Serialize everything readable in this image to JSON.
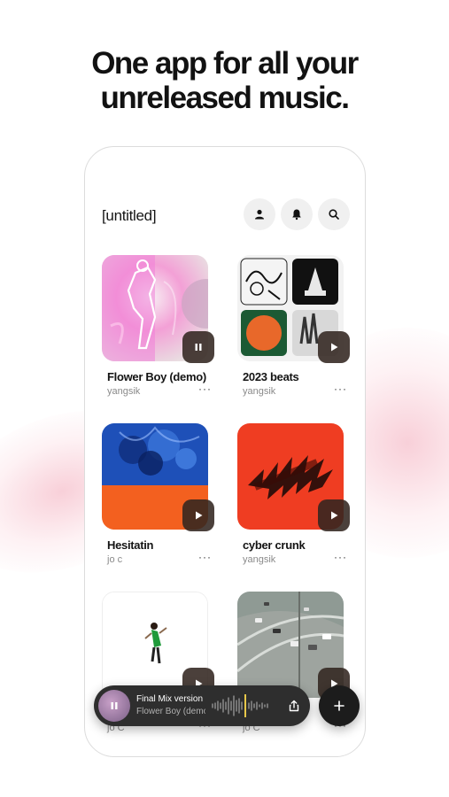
{
  "headline": {
    "line1": "One app for all your",
    "line2": "unreleased music."
  },
  "app": {
    "title": "[untitled]",
    "header_icons": [
      "profile-icon",
      "bell-icon",
      "search-icon"
    ]
  },
  "cards": [
    {
      "title": "Flower Boy (demo)",
      "artist": "yangsik",
      "state": "pause",
      "more": "···"
    },
    {
      "title": "2023 beats",
      "artist": "yangsik",
      "state": "play",
      "more": "···"
    },
    {
      "title": "Hesitatin",
      "artist": "jo c",
      "state": "play",
      "more": "···"
    },
    {
      "title": "cyber crunk",
      "artist": "yangsik",
      "state": "play",
      "more": "···"
    },
    {
      "title": "",
      "artist": "jo C",
      "state": "play",
      "more": "···"
    },
    {
      "title": "",
      "artist": "jo C",
      "state": "play",
      "more": "···"
    }
  ],
  "player": {
    "title": "Final Mix version",
    "subtitle": "Flower Boy (demo)",
    "state": "pause"
  },
  "colors": {
    "accent_bg": "#2e2e2e",
    "fab_bg": "#1c1c1c",
    "waveform_highlight": "#e8c84a"
  }
}
